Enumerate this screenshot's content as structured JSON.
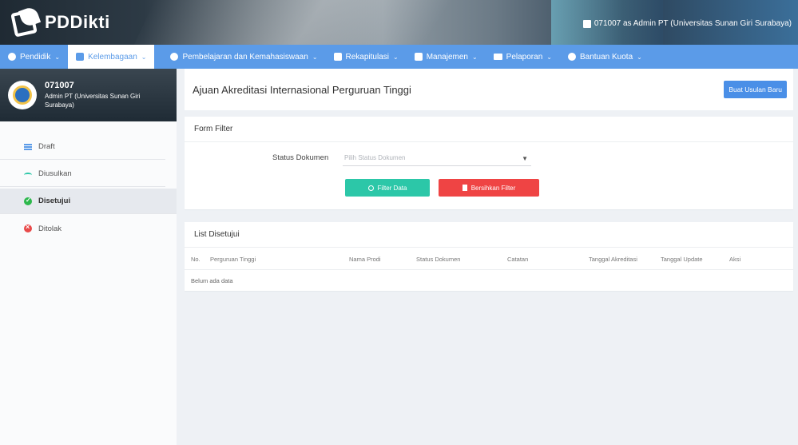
{
  "header": {
    "logo_text": "PDDikti",
    "user_info": "071007 as Admin PT (Universitas Sunan Giri Surabaya)"
  },
  "nav": {
    "items": [
      {
        "label": "Pendidik",
        "icon": "user-circle-icon"
      },
      {
        "label": "Kelembagaan",
        "icon": "institution-icon"
      },
      {
        "label": "Pembelajaran dan Kemahasiswaan",
        "icon": "user-circle-icon"
      },
      {
        "label": "Rekapitulasi",
        "icon": "chart-icon"
      },
      {
        "label": "Manajemen",
        "icon": "document-icon"
      },
      {
        "label": "Pelaporan",
        "icon": "folder-icon"
      },
      {
        "label": "Bantuan Kuota",
        "icon": "user-circle-icon"
      }
    ],
    "active_index": 1
  },
  "sidebar": {
    "profile_code": "071007",
    "profile_name": "Admin PT (Universitas Sunan Giri Surabaya)",
    "items": [
      {
        "label": "Draft",
        "icon": "list-icon"
      },
      {
        "label": "Diusulkan",
        "icon": "proposed-icon"
      },
      {
        "label": "Disetujui",
        "icon": "check-circle-icon"
      },
      {
        "label": "Ditolak",
        "icon": "x-circle-icon"
      }
    ],
    "active_index": 2
  },
  "page": {
    "title": "Ajuan Akreditasi Internasional Perguruan Tinggi",
    "new_button": "Buat Usulan Baru"
  },
  "filter": {
    "title": "Form Filter",
    "status_label": "Status Dokumen",
    "status_placeholder": "Pilih Status Dokumen",
    "filter_button": "Filter Data",
    "clear_button": "Bersihkan Filter"
  },
  "list": {
    "title": "List Disetujui",
    "columns": [
      "No.",
      "Perguruan Tinggi",
      "Nama Prodi",
      "Status Dokumen",
      "Catatan",
      "Tanggal Akreditasi",
      "Tanggal Update",
      "Aksi"
    ],
    "empty_text": "Belum ada data"
  },
  "colors": {
    "nav_bg": "#5b9be8",
    "accent_teal": "#2cc7a8",
    "accent_red": "#ef4444",
    "primary_blue": "#4a8fe7"
  }
}
